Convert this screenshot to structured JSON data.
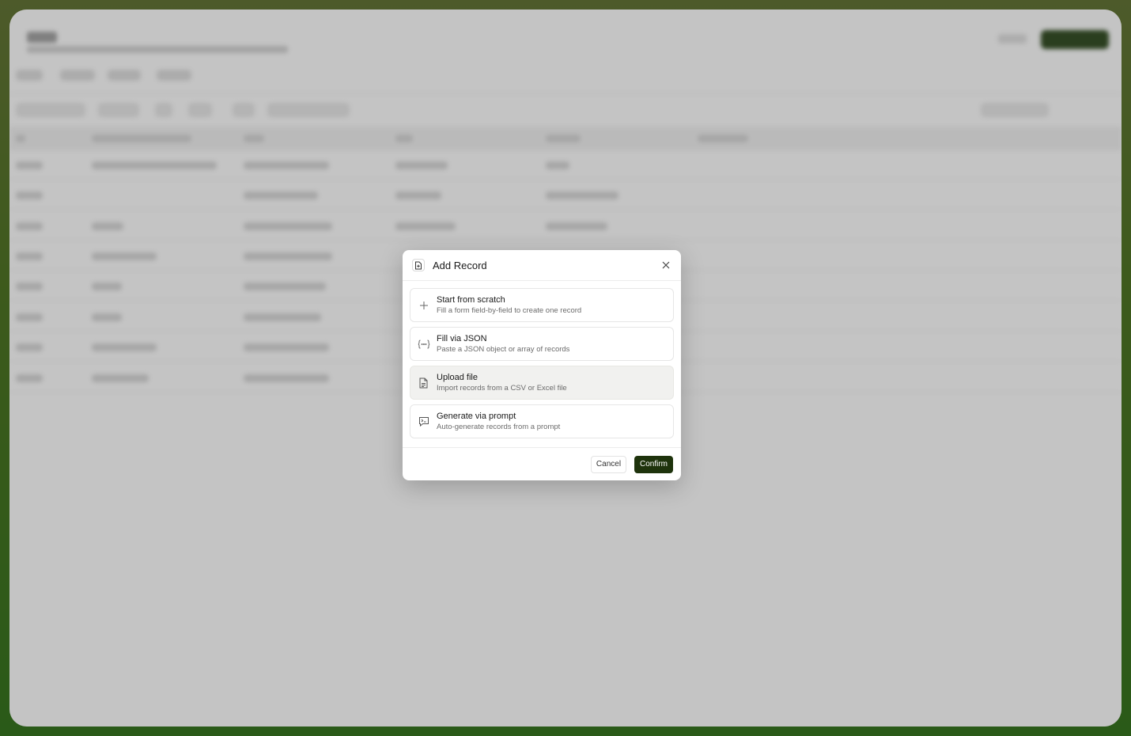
{
  "modal": {
    "title": "Add Record",
    "icon": "file-plus-icon",
    "options": [
      {
        "title": "Start from scratch",
        "description": "Fill a form field-by-field to create one record",
        "icon": "plus-icon",
        "selected": false
      },
      {
        "title": "Fill via JSON",
        "description": "Paste a JSON object or array of records",
        "icon": "braces-icon",
        "selected": false
      },
      {
        "title": "Upload file",
        "description": "Import records from a CSV or Excel file",
        "icon": "file-text-icon",
        "selected": true
      },
      {
        "title": "Generate via prompt",
        "description": "Auto-generate records from a prompt",
        "icon": "terminal-chat-icon",
        "selected": false
      }
    ],
    "cancel_label": "Cancel",
    "confirm_label": "Confirm"
  },
  "colors": {
    "accent": "#1e330c",
    "overlay": "#464646",
    "frame": "#3d5a1c"
  }
}
